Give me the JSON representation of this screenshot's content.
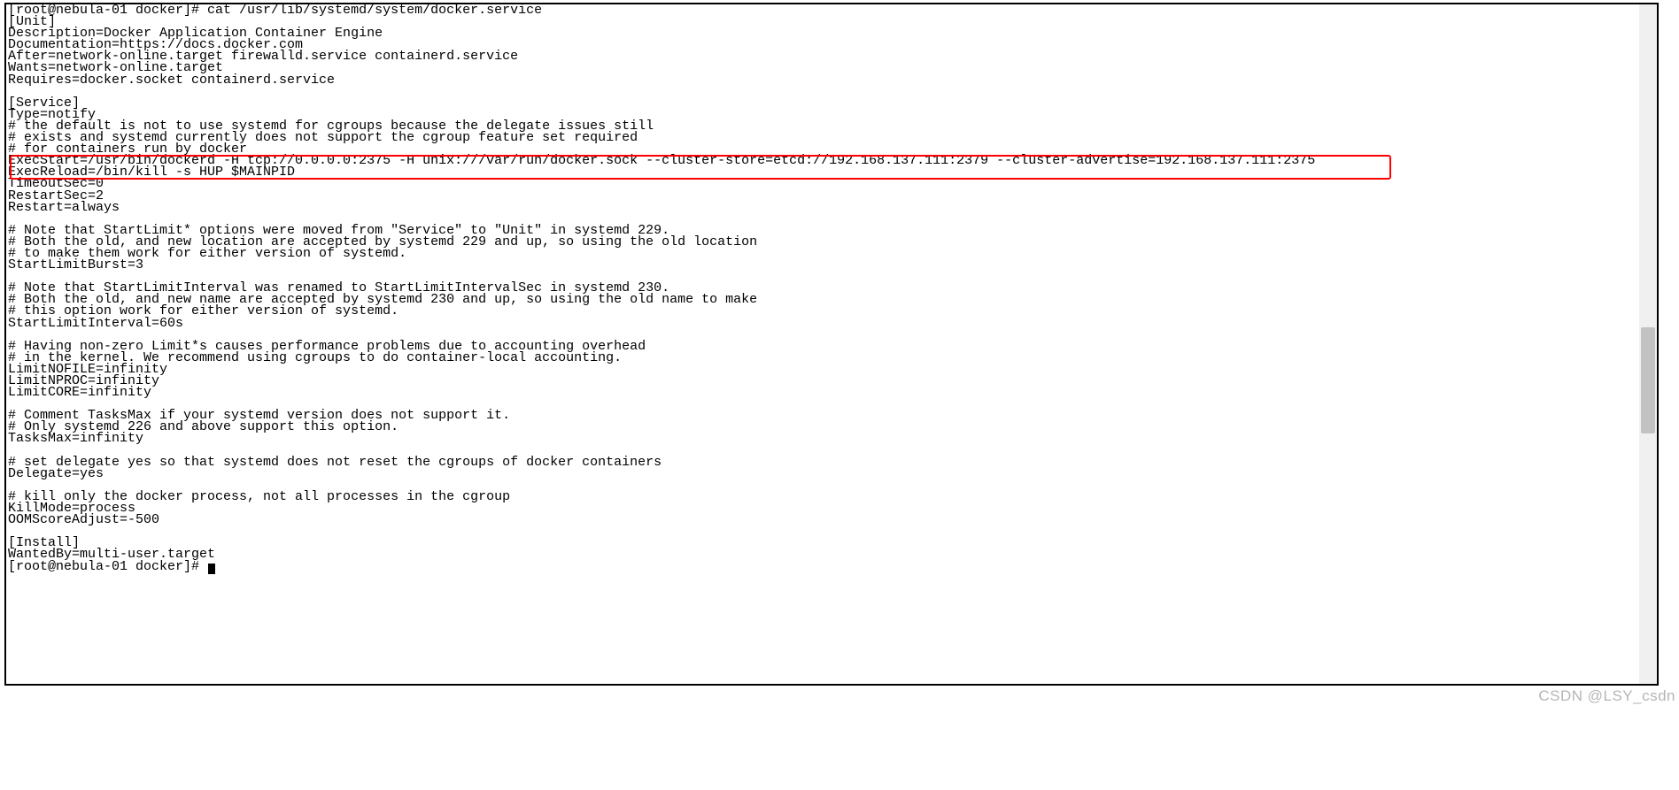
{
  "prompt1": "[root@nebula-01 docker]# cat /usr/lib/systemd/system/docker.service",
  "lines": [
    "[Unit]",
    "Description=Docker Application Container Engine",
    "Documentation=https://docs.docker.com",
    "After=network-online.target firewalld.service containerd.service",
    "Wants=network-online.target",
    "Requires=docker.socket containerd.service",
    "",
    "[Service]",
    "Type=notify",
    "# the default is not to use systemd for cgroups because the delegate issues still",
    "# exists and systemd currently does not support the cgroup feature set required",
    "# for containers run by docker",
    "ExecStart=/usr/bin/dockerd -H tcp://0.0.0.0:2375 -H unix:///var/run/docker.sock --cluster-store=etcd://192.168.137.111:2379 --cluster-advertise=192.168.137.111:2375",
    "ExecReload=/bin/kill -s HUP $MAINPID",
    "TimeoutSec=0",
    "RestartSec=2",
    "Restart=always",
    "",
    "# Note that StartLimit* options were moved from \"Service\" to \"Unit\" in systemd 229.",
    "# Both the old, and new location are accepted by systemd 229 and up, so using the old location",
    "# to make them work for either version of systemd.",
    "StartLimitBurst=3",
    "",
    "# Note that StartLimitInterval was renamed to StartLimitIntervalSec in systemd 230.",
    "# Both the old, and new name are accepted by systemd 230 and up, so using the old name to make",
    "# this option work for either version of systemd.",
    "StartLimitInterval=60s",
    "",
    "# Having non-zero Limit*s causes performance problems due to accounting overhead",
    "# in the kernel. We recommend using cgroups to do container-local accounting.",
    "LimitNOFILE=infinity",
    "LimitNPROC=infinity",
    "LimitCORE=infinity",
    "",
    "# Comment TasksMax if your systemd version does not support it.",
    "# Only systemd 226 and above support this option.",
    "TasksMax=infinity",
    "",
    "# set delegate yes so that systemd does not reset the cgroups of docker containers",
    "Delegate=yes",
    "",
    "# kill only the docker process, not all processes in the cgroup",
    "KillMode=process",
    "OOMScoreAdjust=-500",
    "",
    "[Install]",
    "WantedBy=multi-user.target"
  ],
  "prompt2": "[root@nebula-01 docker]# ",
  "watermark": "CSDN @LSY_csdn"
}
